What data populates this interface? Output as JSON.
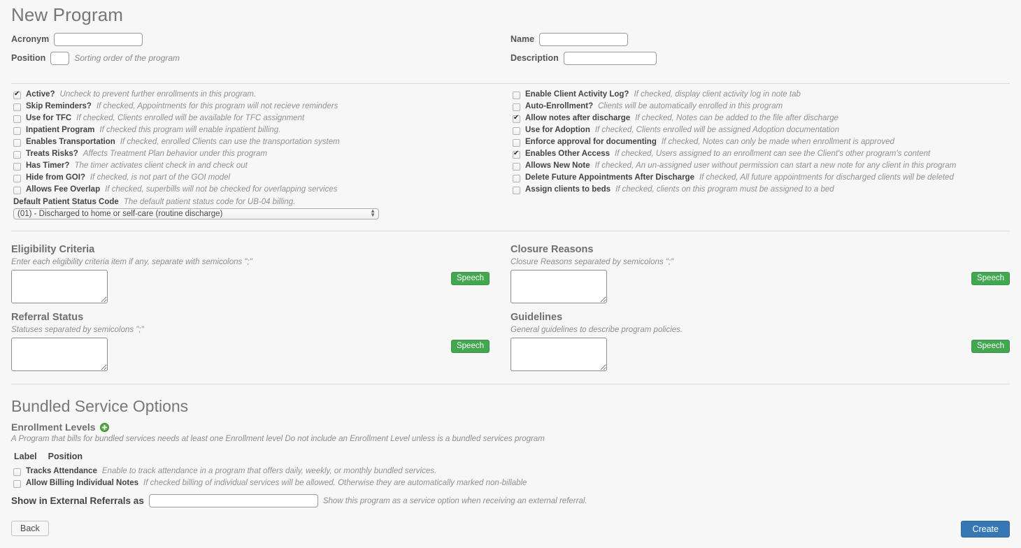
{
  "page_title": "New Program",
  "top_form": {
    "left": [
      {
        "label": "Acronym",
        "value": "",
        "placeholder": "",
        "hint": "",
        "field": "acronym"
      },
      {
        "label": "Position",
        "value": "",
        "placeholder": "",
        "hint": "Sorting order of the program",
        "field": "position"
      }
    ],
    "right": [
      {
        "label": "Name",
        "value": "",
        "placeholder": "",
        "hint": "",
        "field": "name"
      },
      {
        "label": "Description",
        "value": "",
        "placeholder": "",
        "hint": "",
        "field": "description"
      }
    ]
  },
  "checkboxes": {
    "left": [
      {
        "label": "Active?",
        "hint": "Uncheck to prevent further enrollments in this program.",
        "checked": true
      },
      {
        "label": "Skip Reminders?",
        "hint": "If checked, Appointments for this program will not recieve reminders",
        "checked": false
      },
      {
        "label": "Use for TFC",
        "hint": "If checked, Clients enrolled will be available for TFC assignment",
        "checked": false
      },
      {
        "label": "Inpatient Program",
        "hint": "If checked this program will enable inpatient billing.",
        "checked": false
      },
      {
        "label": "Enables Transportation",
        "hint": "If checked, enrolled Clients can use the transportation system",
        "checked": false
      },
      {
        "label": "Treats Risks?",
        "hint": "Affects Treatment Plan behavior under this program",
        "checked": false
      },
      {
        "label": "Has Timer?",
        "hint": "The timer activates client check in and check out",
        "checked": false
      },
      {
        "label": "Hide from GOI?",
        "hint": "If checked, is not part of the GOI model",
        "checked": false
      },
      {
        "label": "Allows Fee Overlap",
        "hint": "If checked, superbills will not be checked for overlapping services",
        "checked": false
      }
    ],
    "right": [
      {
        "label": "Enable Client Activity Log?",
        "hint": "If checked, display client activity log in note tab",
        "checked": false
      },
      {
        "label": "Auto-Enrollment?",
        "hint": "Clients will be automatically enrolled in this program",
        "checked": false
      },
      {
        "label": "Allow notes after discharge",
        "hint": "If checked, Notes can be added to the file after discharge",
        "checked": true
      },
      {
        "label": "Use for Adoption",
        "hint": "If checked, Clients enrolled will be assigned Adoption documentation",
        "checked": false
      },
      {
        "label": "Enforce approval for documenting",
        "hint": "If checked, Notes can only be made when enrollment is approved",
        "checked": false
      },
      {
        "label": "Enables Other Access",
        "hint": "If checked, Users assigned to an enrollment can see the Client's other program's content",
        "checked": true
      },
      {
        "label": "Allows New Note",
        "hint": "If checked, An un-assigned user without permission can start a new note for any client in this program",
        "checked": false
      },
      {
        "label": "Delete Future Appointments After Discharge",
        "hint": "If checked, All future appointments for discharged clients will be deleted",
        "checked": false
      },
      {
        "label": "Assign clients to beds",
        "hint": "If checked, clients on this program must be assigned to a bed",
        "checked": false
      }
    ]
  },
  "patient_status": {
    "label": "Default Patient Status Code",
    "hint": "The default patient status code for UB-04 billing.",
    "selected": "(01) - Discharged to home or self-care (routine discharge)",
    "options": [
      "(01) - Discharged to home or self-care (routine discharge)"
    ]
  },
  "text_blocks": [
    {
      "title": "Eligibility Criteria",
      "hint": "Enter each eligibility criteria item if any, separate with semicolons \";\"",
      "value": "",
      "speech_label": "Speech"
    },
    {
      "title": "Closure Reasons",
      "hint": "Closure Reasons separated by semicolons \";\"",
      "value": "",
      "speech_label": "Speech"
    },
    {
      "title": "Referral Status",
      "hint": "Statuses separated by semicolons \";\"",
      "value": "",
      "speech_label": "Speech"
    },
    {
      "title": "Guidelines",
      "hint": "General guidelines to describe program policies.",
      "value": "",
      "speech_label": "Speech"
    }
  ],
  "bundled": {
    "section_title": "Bundled Service Options",
    "enrollment_levels_label": "Enrollment Levels",
    "add_icon": "plus-circle-icon",
    "hint": "A Program that bills for bundled services needs at least one Enrollment level Do not include an Enrollment Level unless is a bundled services program",
    "columns": {
      "label": "Label",
      "position": "Position"
    },
    "checkboxes": [
      {
        "label": "Tracks Attendance",
        "hint": "Enable to track attendance in a program that offers daily, weekly, or monthly bundled services.",
        "checked": false
      },
      {
        "label": "Allow Billing Individual Notes",
        "hint": "If checked billing of individual services will be allowed. Otherwise they are automatically marked non-billable",
        "checked": false
      }
    ],
    "external_referral": {
      "label": "Show in External Referrals as",
      "value": "",
      "placeholder": "",
      "hint": "Show this program as a service option when receiving an external referral."
    }
  },
  "footer": {
    "back_label": "Back",
    "create_label": "Create"
  },
  "colors": {
    "background": "#f7f7f7",
    "speech_green": "#41a850",
    "create_blue": "#3578b5",
    "divider": "#d3dce6",
    "add_green": "#4faa3f"
  }
}
